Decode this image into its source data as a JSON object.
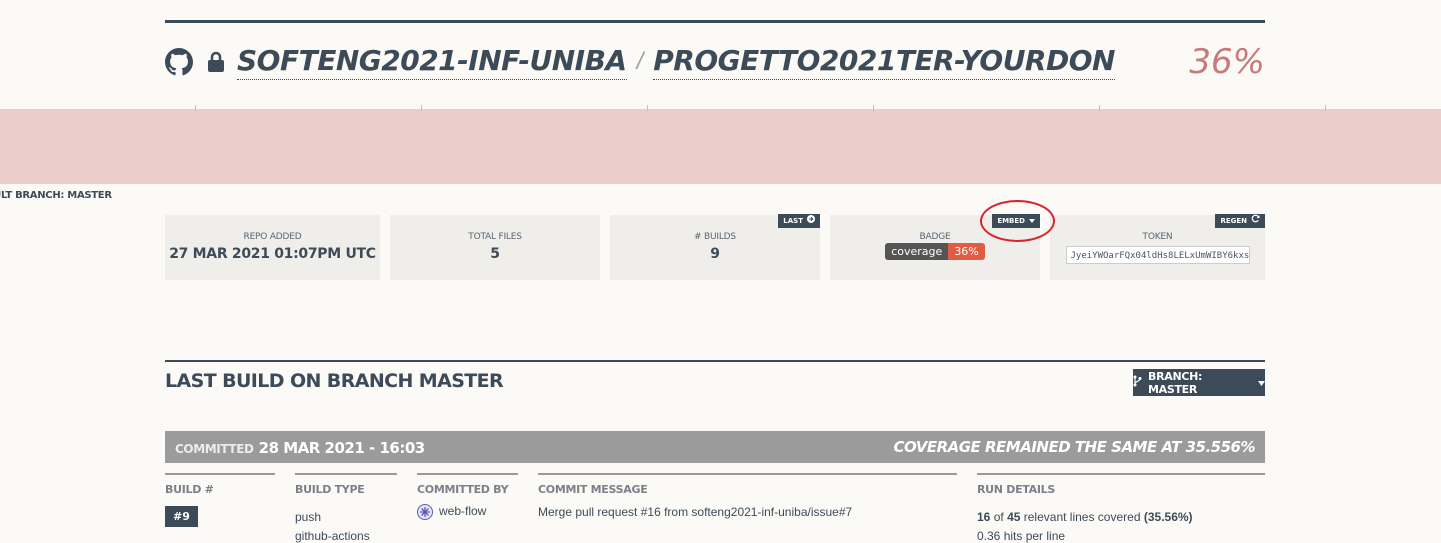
{
  "header": {
    "org": "SOFTENG2021-INF-UNIBA",
    "separator": "/",
    "repo": "PROGETTO2021TER-YOURDON",
    "coverage_percent": "36%"
  },
  "default_branch_label": "AULT BRANCH: MASTER",
  "stats": {
    "repo_added": {
      "label": "REPO ADDED",
      "value": "27 MAR 2021 01:07PM UTC"
    },
    "total_files": {
      "label": "TOTAL FILES",
      "value": "5"
    },
    "builds": {
      "label": "# BUILDS",
      "value": "9",
      "button": "LAST"
    },
    "badge": {
      "label": "BADGE",
      "badge_left": "coverage",
      "badge_right": "36%",
      "button": "EMBED"
    },
    "token": {
      "label": "TOKEN",
      "value": "JyeiYWOarFQx04ldHs8LELxUmWIBY6kxs",
      "button": "REGEN"
    }
  },
  "last_build": {
    "title": "LAST BUILD ON BRANCH MASTER",
    "branch_button": "BRANCH: MASTER",
    "committed_label": "COMMITTED",
    "committed_date": "28 MAR 2021 - 16:03",
    "coverage_status": "COVERAGE REMAINED THE SAME AT 35.556%",
    "columns": {
      "build": {
        "header": "BUILD #",
        "value": "#9"
      },
      "build_type": {
        "header": "BUILD TYPE",
        "value": "push",
        "value2": "github-actions"
      },
      "committed_by": {
        "header": "COMMITTED BY",
        "value": "web-flow"
      },
      "commit_message": {
        "header": "COMMIT MESSAGE",
        "value": "Merge pull request #16 from softeng2021-inf-uniba/issue#7"
      },
      "run_details": {
        "header": "RUN DETAILS",
        "covered": "16",
        "of": "of",
        "relevant": "45",
        "relevant_text": "relevant lines covered",
        "pct": "(35.56%)",
        "line2": "0.36 hits per line"
      }
    }
  },
  "colors": {
    "accent_red": "#c87a78",
    "band": "#ebcdc9",
    "navy": "#3d4b59",
    "badge_red": "#e05d44"
  }
}
